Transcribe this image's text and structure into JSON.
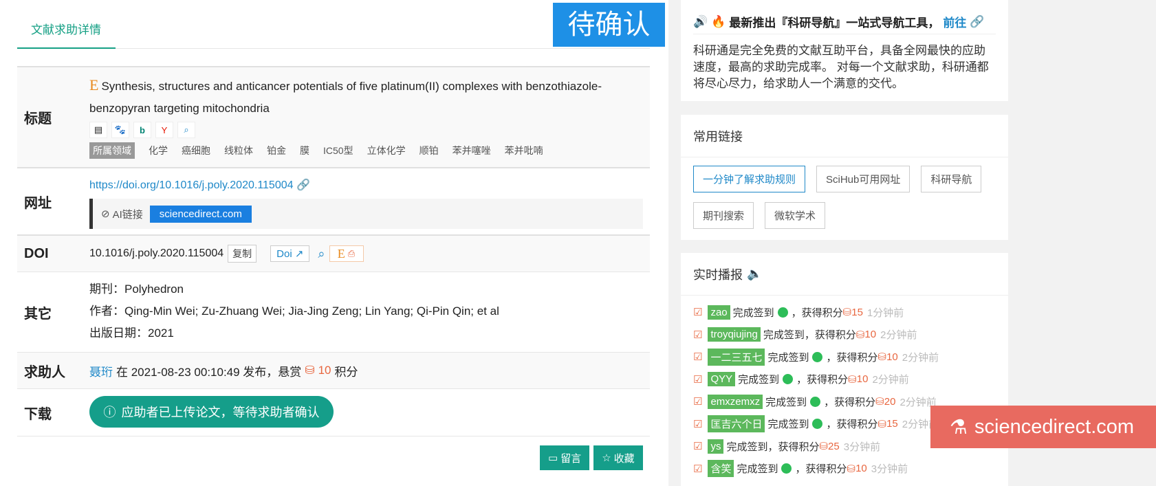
{
  "tabs": {
    "active": "文献求助详情"
  },
  "status": "待确认",
  "labels": {
    "title": "标题",
    "url": "网址",
    "doi": "DOI",
    "other": "其它",
    "requester": "求助人",
    "download": "下载"
  },
  "paper": {
    "title": "Synthesis, structures and anticancer potentials of five platinum(II) complexes with benzothiazole-benzopyran targeting mitochondria",
    "field_tag": "所属领域",
    "keywords": [
      "化学",
      "癌细胞",
      "线粒体",
      "铂金",
      "膜",
      "IC50型",
      "立体化学",
      "顺铂",
      "苯并噻唑",
      "苯并吡喃"
    ],
    "url": "https://doi.org/10.1016/j.poly.2020.115004",
    "ai_link_label": "AI链接",
    "ai_link_button": "sciencedirect.com",
    "doi": "10.1016/j.poly.2020.115004",
    "copy_label": "复制",
    "doi_button": "Doi",
    "journal": "期刊：Polyhedron",
    "authors": "作者：Qing-Min Wei; Zu-Zhuang Wei; Jia-Jing Zeng; Lin Yang; Qi-Pin Qin; et al",
    "pub_date": "出版日期：2021"
  },
  "request": {
    "user": "聂珩",
    "text_before": "在 2021-08-23 00:10:49 发布，悬赏",
    "points": "10",
    "text_after": "积分"
  },
  "download_button": "应助者已上传论文，等待求助者确认",
  "actions": {
    "comment": "留言",
    "favorite": "收藏"
  },
  "notice": {
    "headline": "最新推出『科研导航』一站式导航工具，",
    "go": "前往",
    "body": "科研通是完全免费的文献互助平台，具备全网最快的应助速度，最高的求助完成率。 对每一个文献求助，科研通都将尽心尽力，给求助人一个满意的交代。"
  },
  "links": {
    "title": "常用链接",
    "items": [
      "一分钟了解求助规则",
      "SciHub可用网址",
      "科研导航",
      "期刊搜索",
      "微软学术"
    ]
  },
  "feed": {
    "title": "实时播报",
    "items": [
      {
        "user": "zao",
        "action": "完成签到",
        "wechat": true,
        "gain": "，获得积分",
        "points": "15",
        "time": "1分钟前"
      },
      {
        "user": "troyqiujing",
        "action": "完成签到，获得积分",
        "wechat": false,
        "gain": "",
        "points": "10",
        "time": "2分钟前"
      },
      {
        "user": "一二三五七",
        "action": "完成签到",
        "wechat": true,
        "gain": "，获得积分",
        "points": "10",
        "time": "2分钟前"
      },
      {
        "user": "QYY",
        "action": "完成签到",
        "wechat": true,
        "gain": "，获得积分",
        "points": "10",
        "time": "2分钟前"
      },
      {
        "user": "emxzemxz",
        "action": "完成签到",
        "wechat": true,
        "gain": "，获得积分",
        "points": "20",
        "time": "2分钟前"
      },
      {
        "user": "匡吉六个日",
        "action": "完成签到",
        "wechat": true,
        "gain": "，获得积分",
        "points": "15",
        "time": "2分钟前"
      },
      {
        "user": "ys",
        "action": "完成签到，获得积分",
        "wechat": false,
        "gain": "",
        "points": "25",
        "time": "3分钟前"
      },
      {
        "user": "含笑",
        "action": "完成签到",
        "wechat": true,
        "gain": "，获得积分",
        "points": "10",
        "time": "3分钟前"
      }
    ]
  },
  "overlay": "sciencedirect.com",
  "colors": {
    "accent": "#159e8a",
    "link": "#1e88c8",
    "badge": "#1e90e6",
    "points": "#e8663f",
    "overlay": "#e86a60"
  }
}
